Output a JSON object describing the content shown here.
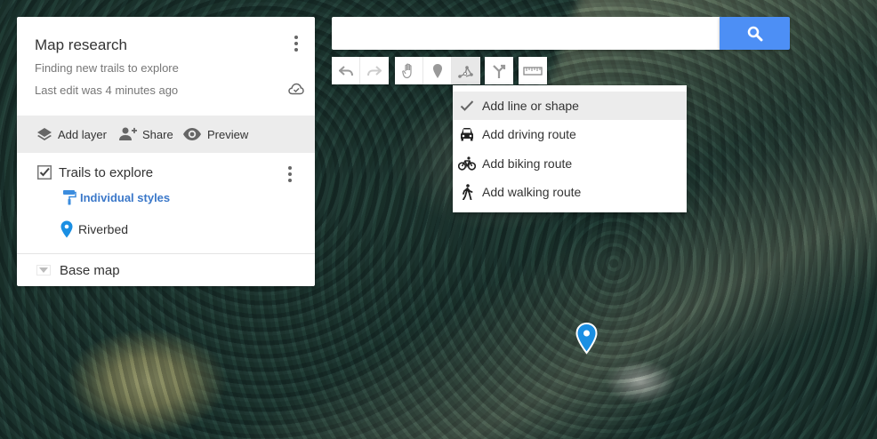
{
  "panel": {
    "title": "Map research",
    "description": "Finding new trails to explore",
    "last_edit": "Last edit was 4 minutes ago",
    "actions": {
      "add_layer": "Add layer",
      "share": "Share",
      "preview": "Preview"
    },
    "layer": {
      "title": "Trails to explore",
      "checked": true,
      "styles_link": "Individual styles",
      "features": [
        {
          "label": "Riverbed",
          "icon": "blue-pin-icon"
        }
      ]
    },
    "base_map": "Base map"
  },
  "search": {
    "placeholder": "",
    "value": ""
  },
  "toolbar": {
    "buttons": [
      "undo",
      "redo",
      "select-hand",
      "add-marker",
      "draw-line",
      "add-directions",
      "measure-distance"
    ],
    "active": "draw-line"
  },
  "draw_menu": {
    "items": [
      {
        "label": "Add line or shape",
        "icon": "check-icon",
        "selected": true
      },
      {
        "label": "Add driving route",
        "icon": "car-icon",
        "selected": false
      },
      {
        "label": "Add biking route",
        "icon": "bike-icon",
        "selected": false
      },
      {
        "label": "Add walking route",
        "icon": "walking-icon",
        "selected": false
      }
    ]
  },
  "colors": {
    "accent_blue": "#4d8ff5",
    "link_blue": "#3b78c9",
    "marker_blue": "#1a8fe3"
  }
}
